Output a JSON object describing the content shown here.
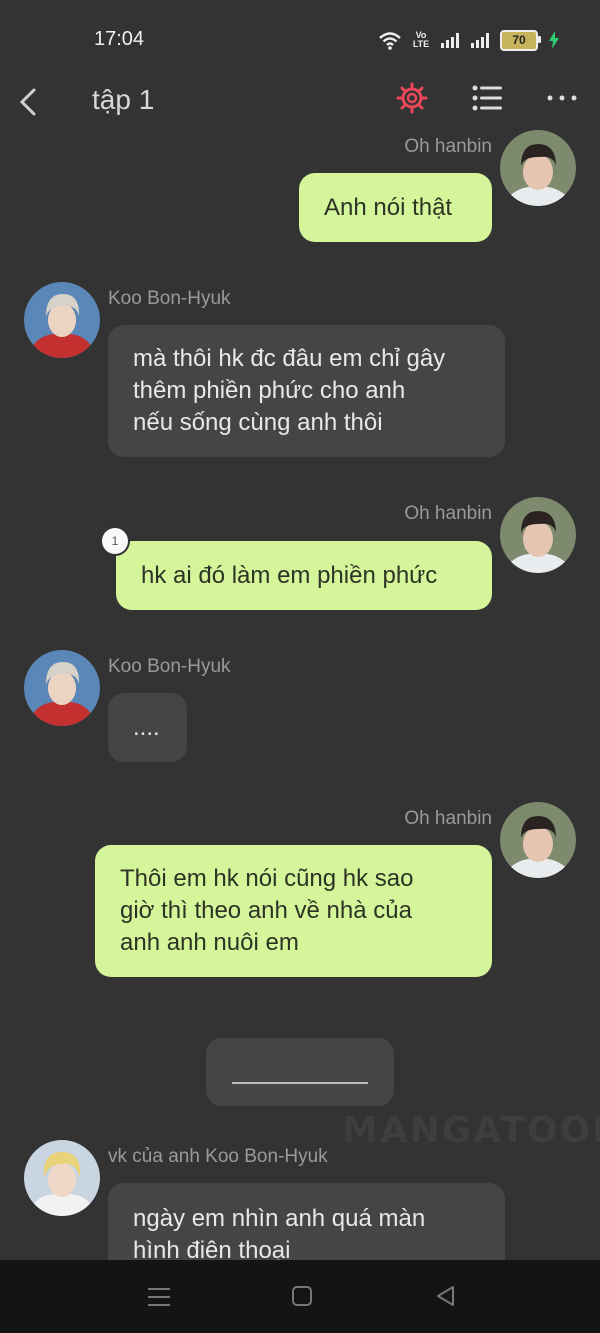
{
  "status_bar": {
    "time": "17:04",
    "volte": "Vo LTE",
    "battery": "70"
  },
  "app_bar": {
    "title": "tập 1"
  },
  "messages": [
    {
      "sender": "Oh hanbin",
      "text": "Anh nói thật"
    },
    {
      "sender": "Koo Bon-Hyuk",
      "lines": [
        "mà thôi hk đc đâu em chỉ gây",
        "thêm phiền phức cho anh",
        "nếu sống cùng anh thôi"
      ]
    },
    {
      "sender": "Oh hanbin",
      "text": "hk ai đó làm em phiền phức",
      "badge": "1"
    },
    {
      "sender": "Koo Bon-Hyuk",
      "text": "...."
    },
    {
      "sender": "Oh hanbin",
      "lines": [
        "Thôi em hk nói cũng hk sao",
        "giờ thì theo anh về nhà của",
        "anh anh nuôi em"
      ]
    },
    {
      "sender": "vk của anh Koo Bon-Hyuk",
      "lines": [
        "ngày em nhìn anh quá màn",
        "hình điên thoại"
      ]
    }
  ],
  "watermark": "MANGATOON",
  "colors": {
    "background": "#333333",
    "green_bubble": "#d4f59a",
    "gray_bubble": "#454545",
    "accent": "#e8475a"
  }
}
